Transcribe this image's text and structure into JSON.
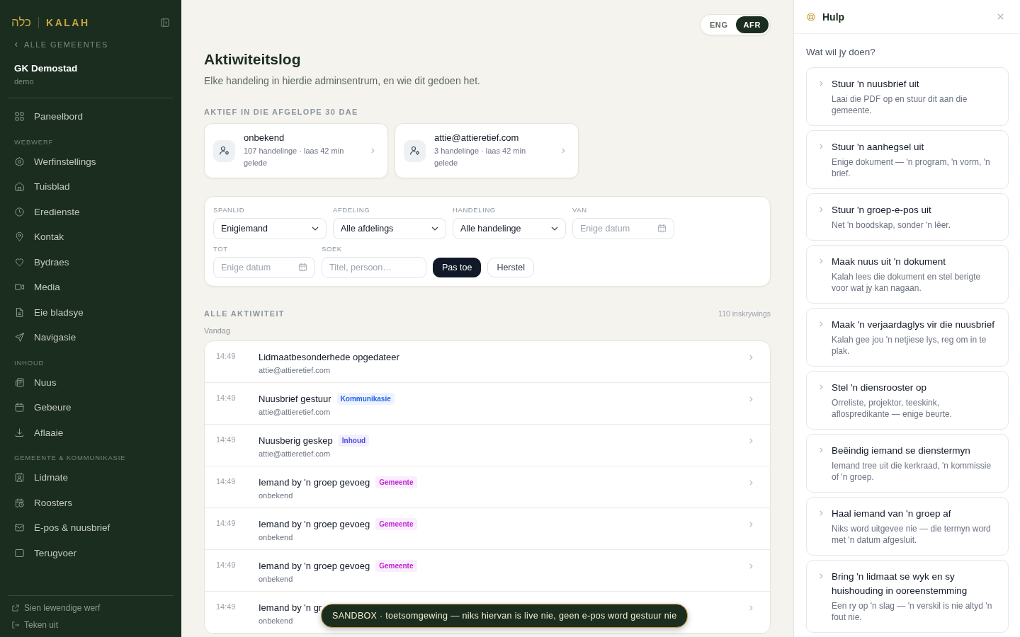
{
  "brand": {
    "hebrew": "כלה",
    "name": "KALAH"
  },
  "back_link": "ALLE GEMEENTES",
  "congregation": {
    "name": "GK Demostad",
    "slug": "demo"
  },
  "nav": [
    {
      "items": [
        "Paneelbord"
      ]
    },
    {
      "heading": "WEBWERF",
      "items": [
        "Werfinstellings",
        "Tuisblad",
        "Eredienste",
        "Kontak",
        "Bydraes",
        "Media",
        "Eie bladsye",
        "Navigasie"
      ]
    },
    {
      "heading": "INHOUD",
      "items": [
        "Nuus",
        "Gebeure",
        "Aflaaie"
      ]
    },
    {
      "heading": "GEMEENTE & KOMMUNIKASIE",
      "items": [
        "Lidmate",
        "Roosters",
        "E-pos & nuusbrief",
        "Terugvoer"
      ]
    }
  ],
  "sidebar_footer": [
    "Sien lewendige werf",
    "Teken uit"
  ],
  "language": [
    {
      "label": "ENG",
      "selected": false
    },
    {
      "label": "AFR",
      "selected": true
    }
  ],
  "page": {
    "title": "Aktiwiteitslog",
    "subtitle": "Elke handeling in hierdie adminsentrum, en wie dit gedoen het."
  },
  "active_users": {
    "heading": "AKTIEF IN DIE AFGELOPE 30 DAE",
    "users": [
      {
        "name": "onbekend",
        "summary": "107 handelinge · laas 42 min gelede"
      },
      {
        "name": "attie@attieretief.com",
        "summary": "3 handelinge · laas 42 min gelede"
      }
    ]
  },
  "filters": {
    "rows": [
      {
        "fields": [
          {
            "label": "SPANLID",
            "kind": "select",
            "value": "Enigiemand"
          },
          {
            "label": "AFDELING",
            "kind": "select",
            "value": "Alle afdelings"
          },
          {
            "label": "HANDELING",
            "kind": "select",
            "value": "Alle handelinge"
          },
          {
            "label": "VAN",
            "kind": "date",
            "placeholder": "Enige datum"
          }
        ]
      },
      {
        "fields": [
          {
            "label": "TOT",
            "kind": "date",
            "placeholder": "Enige datum"
          },
          {
            "label": "SOEK",
            "kind": "text",
            "placeholder": "Titel, persoon…"
          }
        ],
        "buttons": [
          {
            "label": "Pas toe",
            "kind": "primary"
          },
          {
            "label": "Herstel",
            "kind": "secondary"
          }
        ]
      }
    ]
  },
  "activity": {
    "heading": "ALLE AKTIWITEIT",
    "count": "110 inskrywings",
    "day": "Vandag",
    "rows": [
      {
        "time": "14:49",
        "title": "Lidmaatbesonderhede opgedateer",
        "actor": "attie@attieretief.com"
      },
      {
        "time": "14:49",
        "title": "Nuusbrief gestuur",
        "actor": "attie@attieretief.com",
        "tag": {
          "label": "Kommunikasie",
          "color": "#2563eb"
        }
      },
      {
        "time": "14:49",
        "title": "Nuusberig geskep",
        "actor": "attie@attieretief.com",
        "tag": {
          "label": "Inhoud",
          "color": "#4f46e5"
        }
      },
      {
        "time": "14:49",
        "title": "Iemand by 'n groep gevoeg",
        "actor": "onbekend",
        "tag": {
          "label": "Gemeente",
          "color": "#c026d3"
        }
      },
      {
        "time": "14:49",
        "title": "Iemand by 'n groep gevoeg",
        "actor": "onbekend",
        "tag": {
          "label": "Gemeente",
          "color": "#c026d3"
        }
      },
      {
        "time": "14:49",
        "title": "Iemand by 'n groep gevoeg",
        "actor": "onbekend",
        "tag": {
          "label": "Gemeente",
          "color": "#c026d3"
        }
      },
      {
        "time": "14:49",
        "title": "Iemand by 'n gr",
        "actor": "onbekend"
      }
    ]
  },
  "toast": "SANDBOX · toetsomgewing — niks hiervan is live nie, geen e-pos word gestuur nie",
  "help": {
    "title": "Hulp",
    "prompt": "Wat wil jy doen?",
    "actions": [
      {
        "title": "Stuur 'n nuusbrief uit",
        "description": "Laai die PDF op en stuur dit aan die gemeente."
      },
      {
        "title": "Stuur 'n aanhegsel uit",
        "description": "Enige dokument — 'n program, 'n vorm, 'n brief."
      },
      {
        "title": "Stuur 'n groep-e-pos uit",
        "description": "Net 'n boodskap, sonder 'n lêer."
      },
      {
        "title": "Maak nuus uit 'n dokument",
        "description": "Kalah lees die dokument en stel berigte voor wat jy kan nagaan."
      },
      {
        "title": "Maak 'n verjaardaglys vir die nuusbrief",
        "description": "Kalah gee jou 'n netjiese lys, reg om in te plak."
      },
      {
        "title": "Stel 'n diensrooster op",
        "description": "Orreliste, projektor, teeskink, aflospredikante — enige beurte."
      },
      {
        "title": "Beëindig iemand se dienstermyn",
        "description": "Iemand tree uit die kerkraad, 'n kommissie of 'n groep."
      },
      {
        "title": "Haal iemand van 'n groep af",
        "description": "Niks word uitgevee nie — die termyn word met 'n datum afgesluit."
      },
      {
        "title": "Bring 'n lidmaat se wyk en sy huishouding in ooreenstemming",
        "description": "Een ry op 'n slag — 'n verskil is nie altyd 'n fout nie."
      }
    ]
  }
}
